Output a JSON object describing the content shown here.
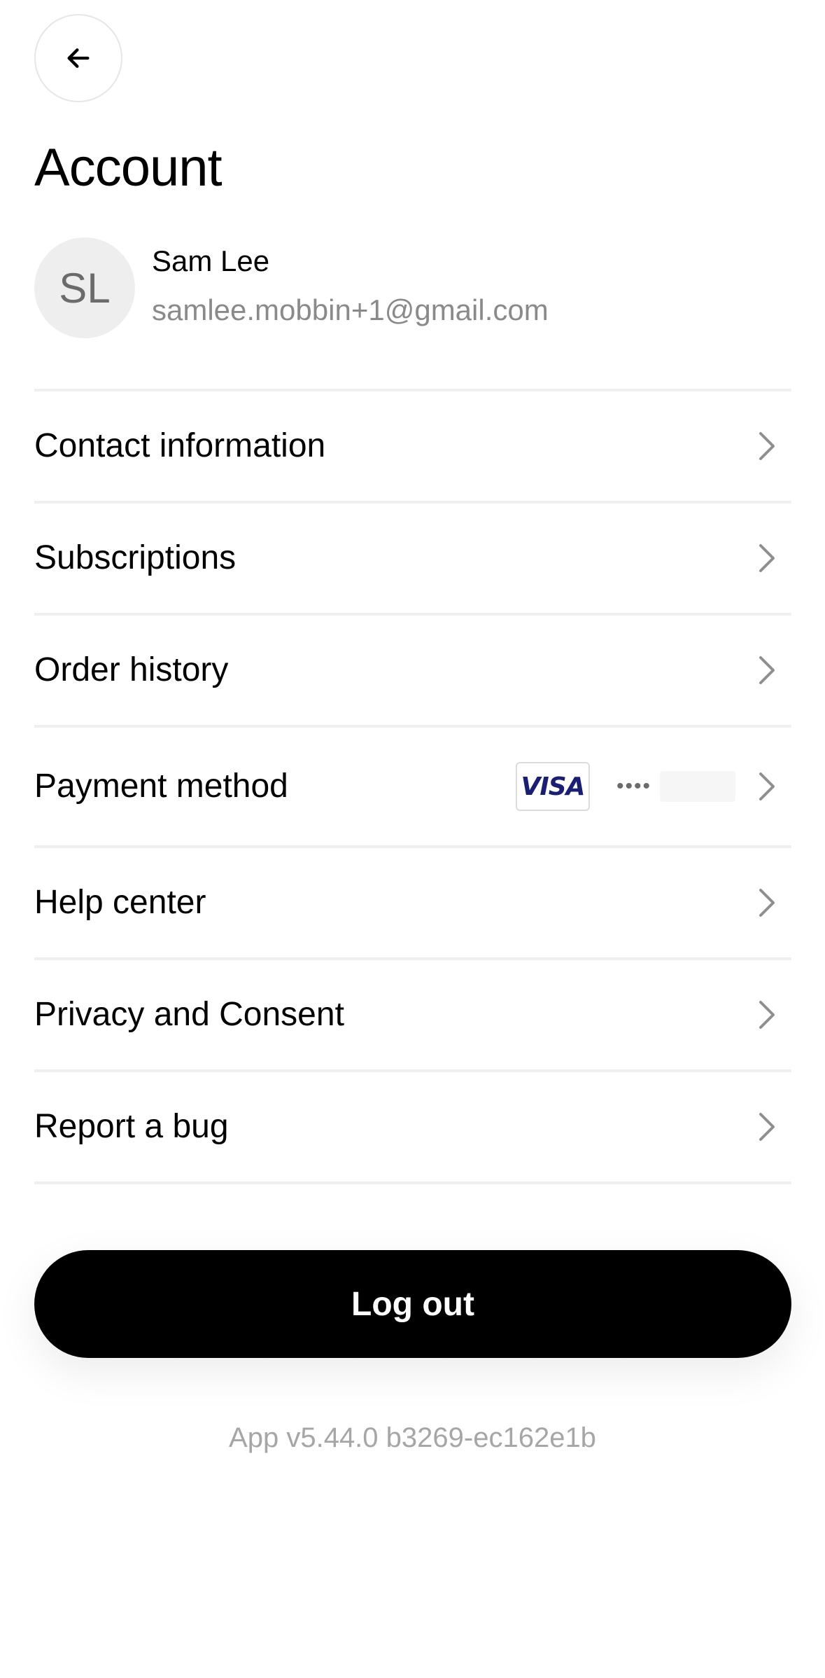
{
  "header": {
    "back_icon": "arrow-left-icon",
    "title": "Account"
  },
  "profile": {
    "initials": "SL",
    "name": "Sam Lee",
    "email": "samlee.mobbin+1@gmail.com"
  },
  "menu": {
    "items": [
      {
        "label": "Contact information"
      },
      {
        "label": "Subscriptions"
      },
      {
        "label": "Order history"
      },
      {
        "label": "Payment method",
        "card_brand": "VISA",
        "card_dots": "••••"
      },
      {
        "label": "Help center"
      },
      {
        "label": "Privacy and Consent"
      },
      {
        "label": "Report a bug"
      }
    ],
    "chevron_icon": "chevron-right-icon"
  },
  "logout": {
    "label": "Log out"
  },
  "footer": {
    "version": "App v5.44.0 b3269-ec162e1b"
  },
  "colors": {
    "text": "#000000",
    "muted": "#8a8a8a",
    "divider": "#efefef",
    "button_bg": "#000000",
    "visa_blue": "#1a1f71"
  }
}
